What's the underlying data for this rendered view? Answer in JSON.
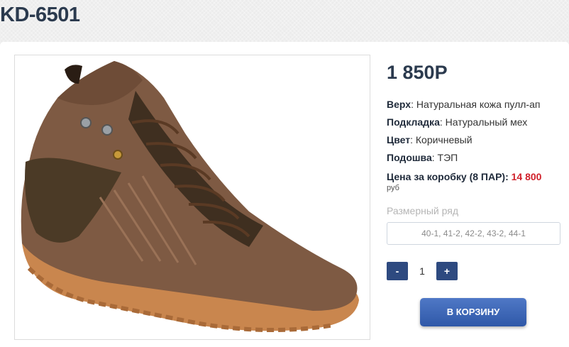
{
  "product": {
    "title": "KD-6501",
    "price": "1 850Р",
    "image_alt": "Коричневые кожаные ботинки"
  },
  "specs": [
    {
      "label": "Верх",
      "value": ": Натуральная кожа пулл-ап"
    },
    {
      "label": "Подкладка",
      "value": ": Натуральный мех"
    },
    {
      "label": "Цвет",
      "value": ": Коричневый"
    },
    {
      "label": "Подошва",
      "value": ": ТЭП"
    }
  ],
  "box_price": {
    "label": "Цена за коробку (8 ПАР):",
    "value": "14 800",
    "currency": "руб"
  },
  "size_row": {
    "label": "Размерный ряд",
    "value": "40-1, 41-2, 42-2, 43-2, 44-1"
  },
  "quantity": {
    "minus": "-",
    "value": "1",
    "plus": "+"
  },
  "cart_button": "В КОРЗИНУ",
  "colors": {
    "accent": "#2e4a80",
    "price_red": "#d0202a",
    "cart_button": "#3d67b8"
  }
}
